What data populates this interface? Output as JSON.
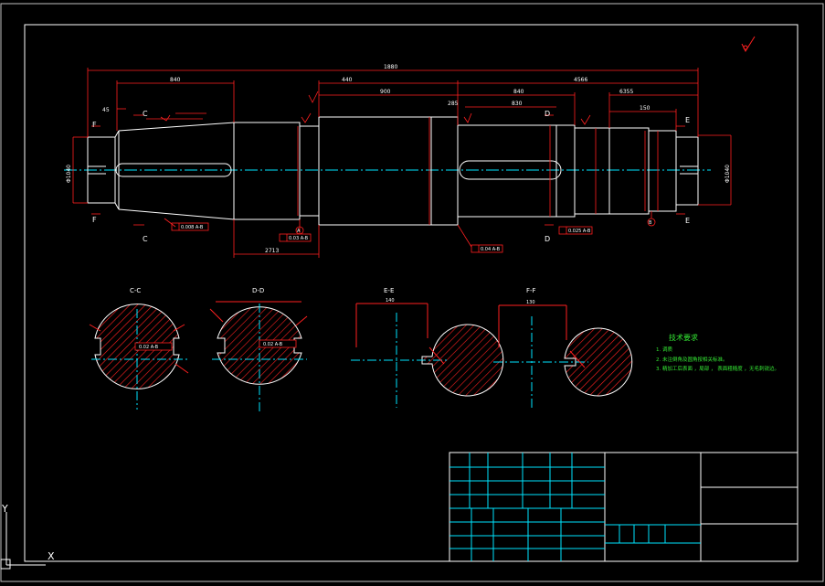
{
  "colors": {
    "background": "#000000",
    "frame": "#ffffff",
    "outline": "#ffffff",
    "dimension": "#ff2020",
    "centerline": "#00e5ff",
    "hatch": "#ff2020",
    "text_green": "#34e834",
    "title_block": "#00e5ff"
  },
  "drawing": {
    "dim_overall": "1880",
    "dim_left": "840",
    "dim_mid": "440",
    "dim_mid2": "900",
    "dim_mid3": "285",
    "dim_right": "4566",
    "dim_right2": "840",
    "dim_right3": "6355",
    "dim_right4": "150",
    "dim_right5": "830",
    "dim_bottom": "2713",
    "dim_small": "45",
    "tol_left": "0.008 A-B",
    "tol_center": "0.03 A-B",
    "tol_center2": "0.04 A-B",
    "tol_right": "0.025 A-B",
    "datum_a": "A",
    "datum_b": "B",
    "cut_c": "C",
    "cut_d": "D",
    "cut_e": "E",
    "cut_f": "F",
    "dia_left": "Φ1040",
    "dia_right": "Φ1040"
  },
  "sections": [
    {
      "label": "C-C",
      "dim": "0.02 A-B"
    },
    {
      "label": "D-D",
      "dim": "0.02 A-B"
    },
    {
      "label": "E-E",
      "dim": "140"
    },
    {
      "label": "F-F",
      "dim": "130"
    }
  ],
  "notes": {
    "title": "技术要求",
    "line1": "1. 调质",
    "line2": "2. 未注倒角及圆角按相关标准。",
    "line3": "3. 精加工后表面 ，局部 ， 表面粗糙度 ，无毛刺锐边。"
  },
  "axes": {
    "x": "X",
    "y": "Y"
  }
}
